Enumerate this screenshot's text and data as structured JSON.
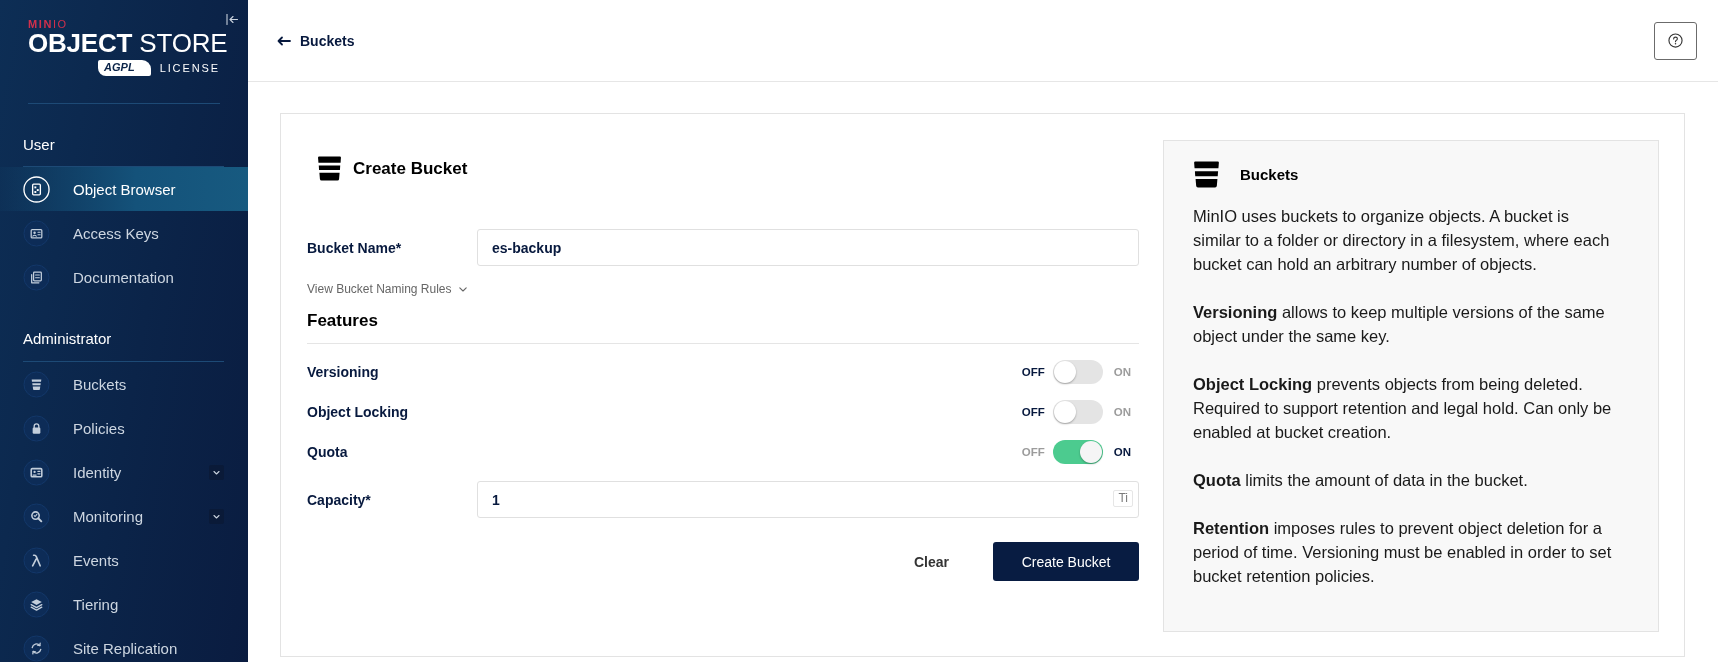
{
  "sidebar": {
    "brand": {
      "vendor": "**MIN**IO",
      "product": "**OBJECT** STORE",
      "badge": "AGPL",
      "license": "LICENSE"
    },
    "sections": [
      {
        "title": "User",
        "items": [
          {
            "label": "Object Browser",
            "selected": true,
            "expandable": false
          },
          {
            "label": "Access Keys",
            "selected": false,
            "expandable": false
          },
          {
            "label": "Documentation",
            "selected": false,
            "expandable": false
          }
        ]
      },
      {
        "title": "Administrator",
        "items": [
          {
            "label": "Buckets",
            "selected": false,
            "expandable": false
          },
          {
            "label": "Policies",
            "selected": false,
            "expandable": false
          },
          {
            "label": "Identity",
            "selected": false,
            "expandable": true
          },
          {
            "label": "Monitoring",
            "selected": false,
            "expandable": true
          },
          {
            "label": "Events",
            "selected": false,
            "expandable": false
          },
          {
            "label": "Tiering",
            "selected": false,
            "expandable": false
          },
          {
            "label": "Site Replication",
            "selected": false,
            "expandable": false
          }
        ]
      }
    ]
  },
  "header": {
    "back_link": "Buckets"
  },
  "form": {
    "title": "Create Bucket",
    "rows": [
      {
        "kind": "input",
        "label": "Bucket Name*",
        "value": "es-backup"
      },
      {
        "kind": "expander",
        "label": "View Bucket Naming Rules",
        "expanded": false
      },
      {
        "kind": "section",
        "label": "Features"
      },
      {
        "kind": "toggle",
        "label": "Versioning",
        "off_text": "OFF",
        "on_text": "ON",
        "on": false
      },
      {
        "kind": "toggle",
        "label": "Object Locking",
        "off_text": "OFF",
        "on_text": "ON",
        "on": false
      },
      {
        "kind": "toggle",
        "label": "Quota",
        "off_text": "OFF",
        "on_text": "ON",
        "on": true
      },
      {
        "kind": "input",
        "label": "Capacity*",
        "value": "1",
        "unit": "Ti"
      }
    ],
    "buttons": [
      {
        "label": "Clear",
        "kind": "text"
      },
      {
        "label": "Create Bucket",
        "kind": "primary"
      }
    ]
  },
  "info_panel": {
    "title": "Buckets",
    "paragraphs": [
      "MinIO uses buckets to organize objects. A bucket is similar to a folder or directory in a filesystem, where each bucket can hold an arbitrary number of objects.",
      "**Versioning** allows to keep multiple versions of the same object under the same key.",
      "**Object Locking** prevents objects from being deleted. Required to support retention and legal hold. Can only be enabled at bucket creation.",
      "**Quota** limits the amount of data in the bucket.",
      "**Retention** imposes rules to prevent object deletion for a period of time. Versioning must be enabled in order to set bucket retention policies."
    ]
  }
}
